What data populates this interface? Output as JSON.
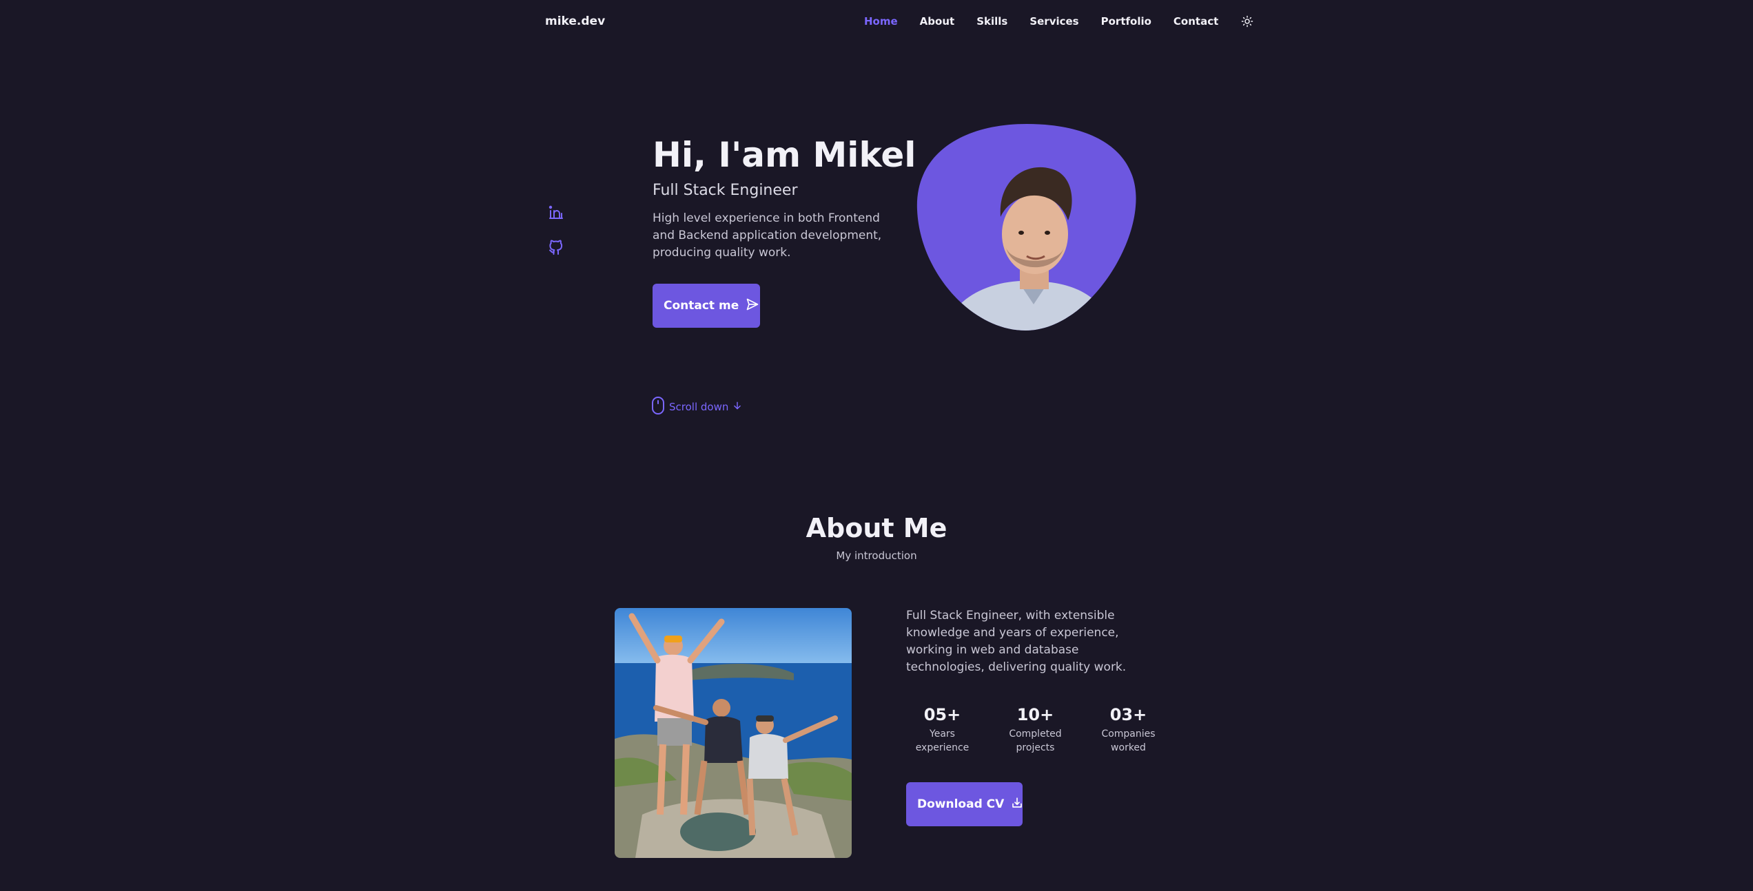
{
  "header": {
    "brand": "mike.dev",
    "nav": [
      "Home",
      "About",
      "Skills",
      "Services",
      "Portfolio",
      "Contact"
    ],
    "active_nav": "Home"
  },
  "hero": {
    "title": "Hi, I'am Mikel",
    "subtitle": "Full Stack Engineer",
    "description": "High level experience in both Frontend and Backend application development, producing quality work.",
    "contact_button": "Contact me",
    "scroll_label": "Scroll down"
  },
  "social": [
    {
      "icon": "linkedin-icon"
    },
    {
      "icon": "github-icon"
    }
  ],
  "about": {
    "title": "About Me",
    "subtitle": "My introduction",
    "description": "Full Stack Engineer, with extensible knowledge and years of experience, working in web and database technologies, delivering quality work.",
    "stats": [
      {
        "value": "05+",
        "label_line1": "Years",
        "label_line2": "experience"
      },
      {
        "value": "10+",
        "label_line1": "Completed",
        "label_line2": "projects"
      },
      {
        "value": "03+",
        "label_line1": "Companies",
        "label_line2": "worked"
      }
    ],
    "cv_button": "Download CV"
  },
  "colors": {
    "background": "#1a1726",
    "accent": "#6d57e0",
    "accent_text": "#7b67ff",
    "text": "#f2f1f7"
  }
}
